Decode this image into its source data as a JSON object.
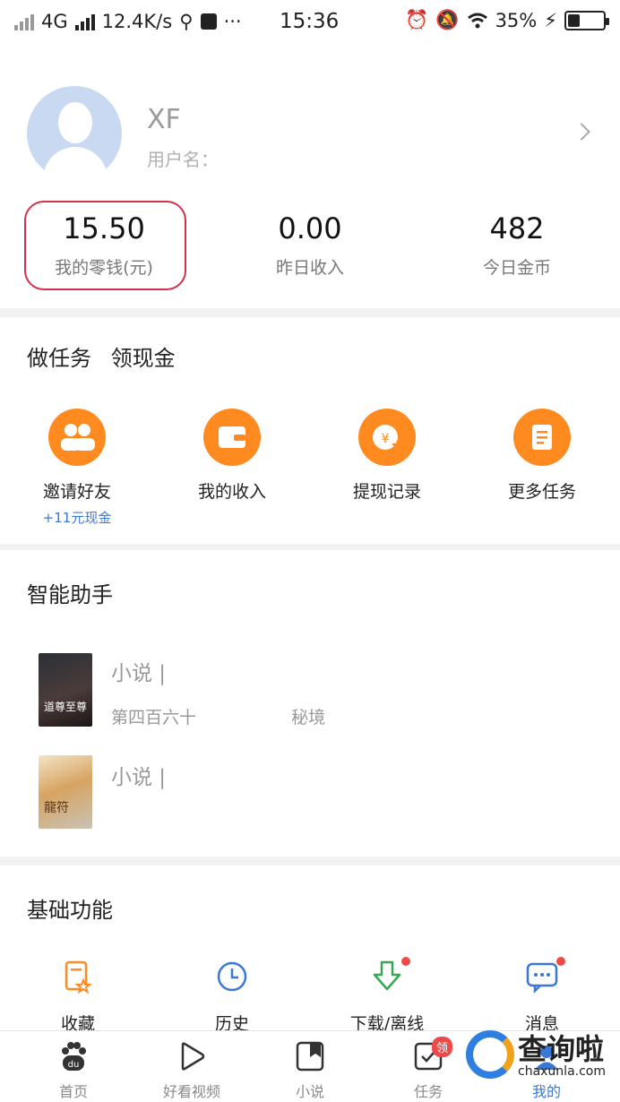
{
  "status_bar": {
    "network": "4G",
    "speed": "12.4K/s",
    "more": "···",
    "time": "15:36",
    "battery": "35%",
    "battery_level": 0.35
  },
  "profile": {
    "name": "XF",
    "username_label": "用户名：",
    "stats": [
      {
        "value": "15.50",
        "label": "我的零钱(元)"
      },
      {
        "value": "0.00",
        "label": "昨日收入"
      },
      {
        "value": "482",
        "label": "今日金币"
      }
    ]
  },
  "tasks": {
    "title_1": "做任务",
    "title_2": "领现金",
    "items": [
      {
        "label": "邀请好友",
        "sub": "+11元现金",
        "icon": "users-icon"
      },
      {
        "label": "我的收入",
        "icon": "wallet-icon"
      },
      {
        "label": "提现记录",
        "icon": "yuan-withdraw-icon"
      },
      {
        "label": "更多任务",
        "icon": "document-icon"
      }
    ]
  },
  "assistant": {
    "title": "智能助手",
    "books": [
      {
        "title": "小说 |",
        "chapter": "第四百六十",
        "chapter_tail": "秘境",
        "cover_text": "道尊至尊"
      },
      {
        "title": "小说 |",
        "cover_text": "龍符"
      }
    ]
  },
  "basic": {
    "title": "基础功能",
    "items": [
      {
        "label": "收藏",
        "icon": "favorite-doc-icon"
      },
      {
        "label": "历史",
        "icon": "clock-icon"
      },
      {
        "label": "下载/离线",
        "icon": "download-icon",
        "dot": true
      },
      {
        "label": "消息",
        "icon": "message-icon",
        "dot": true
      }
    ]
  },
  "bottom_nav": {
    "items": [
      {
        "label": "首页",
        "icon": "paw-du-icon"
      },
      {
        "label": "好看视频",
        "icon": "play-icon"
      },
      {
        "label": "小说",
        "icon": "book-icon"
      },
      {
        "label": "任务",
        "icon": "task-check-icon",
        "badge": "领"
      },
      {
        "label": "我的",
        "icon": "profile-icon",
        "active": true
      }
    ]
  },
  "watermark": {
    "title": "查询啦",
    "url": "chaxunla.com"
  },
  "colors": {
    "accent": "#ff8a1f",
    "link": "#3a78d6",
    "highlight": "#d2314a",
    "dot": "#ef4a4a"
  }
}
